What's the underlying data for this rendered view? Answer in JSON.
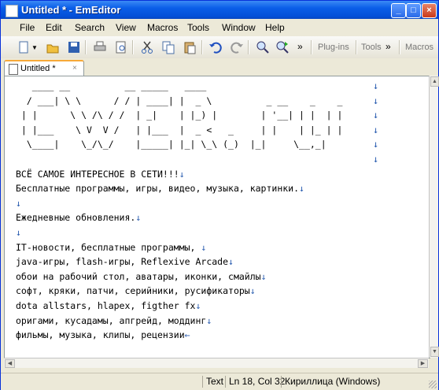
{
  "window": {
    "title": "Untitled * - EmEditor"
  },
  "menu": [
    "File",
    "Edit",
    "Search",
    "View",
    "Macros",
    "Tools",
    "Window",
    "Help"
  ],
  "toolbar": {
    "more": "»",
    "plugins": "Plug-ins",
    "tools": "Tools",
    "macros": "Macros"
  },
  "tab": {
    "label": "Untitled *",
    "close": "×"
  },
  "editor": {
    "lines": [
      "   ____ __          __ _____   ____",
      "  / ___| \\ \\      / / | ____| |  _ \\          _ __    _    _",
      " | |      \\ \\ /\\ / /  | _|    | |_) |        | '__| | |  | |",
      " | |___    \\ V  V /   | |___  |  _ <   _     | |    | |_ | |",
      "  \\____|    \\_/\\_/    |_____| |_| \\_\\ (_)  |_|     \\__,_|",
      "",
      "ВСЁ САМОЕ ИНТЕРЕСНОЕ В СЕТИ!!!",
      "Бесплатные программы, игры, видео, музыка, картинки.",
      "",
      "Ежедневные обновления.",
      "",
      "IT-новости, бесплатные программы, ",
      "java-игры, flash-игры, Reflexive Arcade",
      "обои на рабочий стол, аватары, иконки, смайлы",
      "софт, кряки, патчи, серийники, русификаторы",
      "dota allstars, hlapex, figther fx",
      "оригами, кусадамы, апгрейд, моддинг",
      "фильмы, музыка, клипы, рецензии"
    ],
    "newline_mark": "↓",
    "eof_mark": "←"
  },
  "status": {
    "mode": "Text",
    "position": "Ln 18, Col 32",
    "encoding": "Кириллица (Windows)"
  }
}
